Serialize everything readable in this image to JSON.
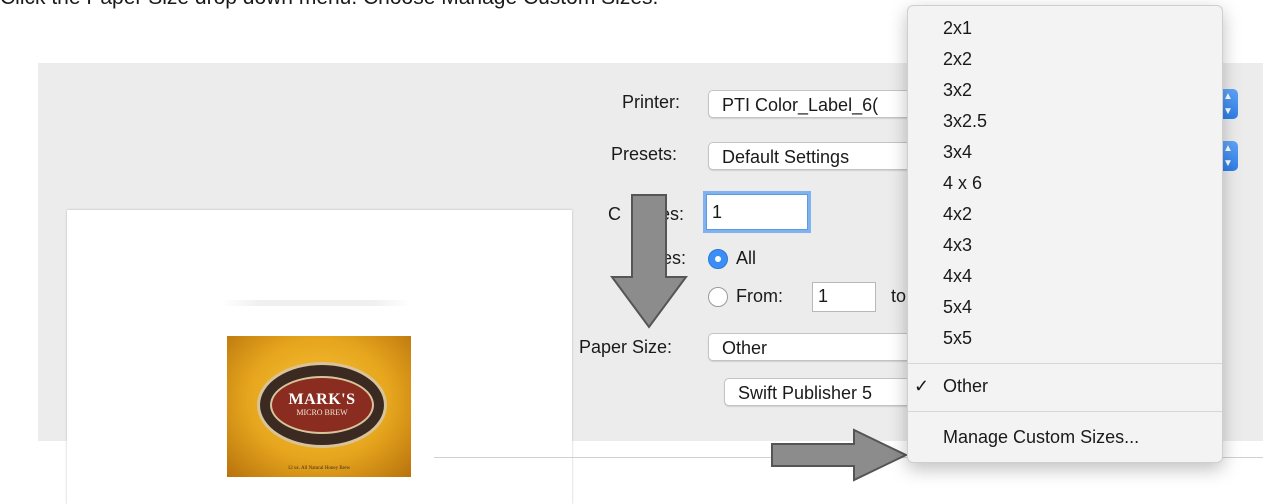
{
  "instruction": "Click the Paper Size drop down menu.  Choose Manage Custom Sizes.",
  "preview": {
    "label_title": "MARK'S",
    "label_subtitle": "MICRO BREW",
    "label_footer": "12 oz. All Natural Honey Brew"
  },
  "form": {
    "printer_label": "Printer:",
    "printer_value": "PTI Color_Label_6(",
    "presets_label": "Presets:",
    "presets_value": "Default Settings",
    "copies_label_visible": "C",
    "copies_label_tail": "ies:",
    "copies_value": "1",
    "pages_label_tail": "ges:",
    "pages_all_label": "All",
    "pages_from_label": "From:",
    "pages_from_value": "1",
    "pages_to_fragment": "to",
    "paper_size_label": "Paper Size:",
    "paper_size_value": "Other",
    "app_section_value": "Swift Publisher 5"
  },
  "menu": {
    "items": [
      "2x1",
      "2x2",
      "3x2",
      "3x2.5",
      "3x4",
      "4 x 6",
      "4x2",
      "4x3",
      "4x4",
      "5x4",
      "5x5"
    ],
    "selected_label": "Other",
    "selected_check": "✓",
    "manage_label": "Manage Custom Sizes..."
  },
  "colors": {
    "accent_blue": "#3b8ef5",
    "menu_background": "#f3f3f3",
    "dialog_background": "#ececec",
    "arrow_fill": "#8c8c8c"
  },
  "icons": {
    "arrows": [
      "down-arrow-icon",
      "right-arrow-icon"
    ],
    "stepper": "stepper-icon"
  }
}
